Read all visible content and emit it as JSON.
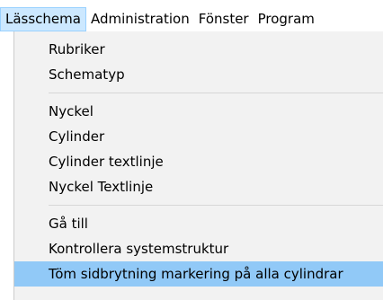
{
  "menubar": {
    "items": [
      {
        "label": "Lässchema"
      },
      {
        "label": "Administration"
      },
      {
        "label": "Fönster"
      },
      {
        "label": "Program"
      }
    ]
  },
  "dropdown": {
    "group1": [
      {
        "label": "Rubriker"
      },
      {
        "label": "Schematyp"
      }
    ],
    "group2": [
      {
        "label": "Nyckel"
      },
      {
        "label": "Cylinder"
      },
      {
        "label": "Cylinder textlinje"
      },
      {
        "label": "Nyckel Textlinje"
      }
    ],
    "group3": [
      {
        "label": "Gå till"
      },
      {
        "label": "Kontrollera systemstruktur"
      },
      {
        "label": "Töm sidbrytning markering på alla cylindrar"
      }
    ]
  }
}
